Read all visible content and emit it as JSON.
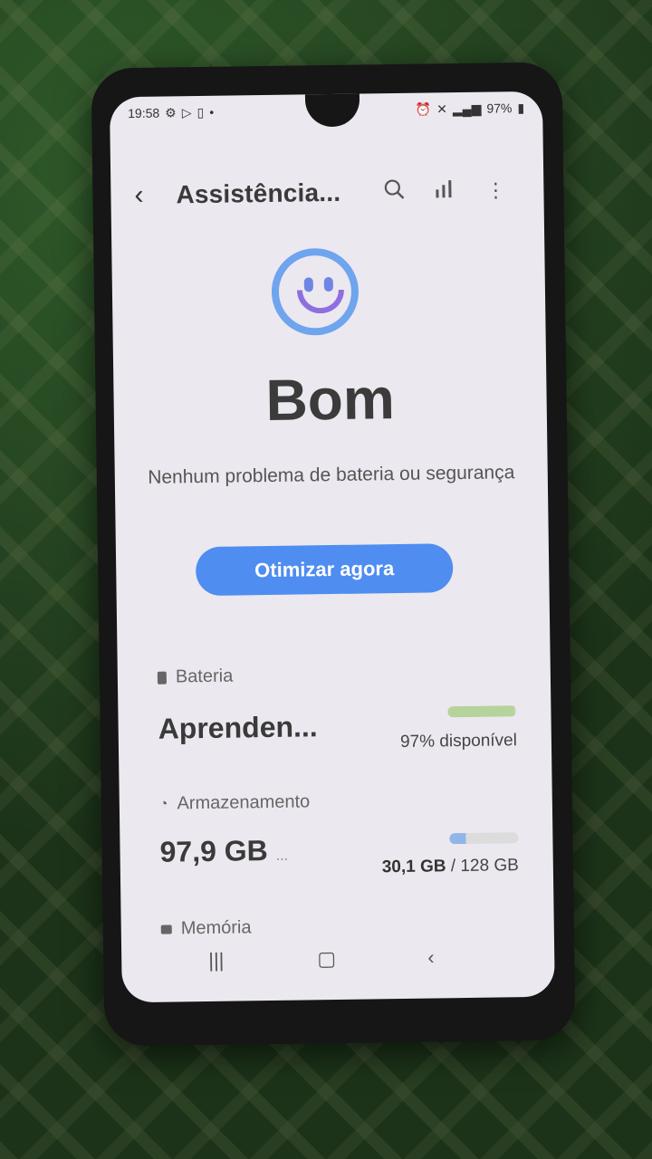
{
  "status": {
    "time": "19:58",
    "battery": "97%"
  },
  "appbar": {
    "title": "Assistência..."
  },
  "hero": {
    "rating": "Bom",
    "description": "Nenhum problema de bateria ou segurança"
  },
  "optimize_button": "Otimizar agora",
  "battery": {
    "label": "Bateria",
    "value": "Aprenden...",
    "detail": "97% disponível",
    "level": 0.97,
    "bar_color": "#b5d39b"
  },
  "storage": {
    "label": "Armazenamento",
    "value": "97,9 GB",
    "suffix": "...",
    "used": "30,1 GB",
    "separator": "/",
    "total": "128 GB",
    "used_fraction": 0.235,
    "bar_color": "#8fb6e6"
  },
  "memory": {
    "label": "Memória"
  },
  "colors": {
    "accent": "#4f8df0",
    "smiley": "#6fa4ee"
  }
}
